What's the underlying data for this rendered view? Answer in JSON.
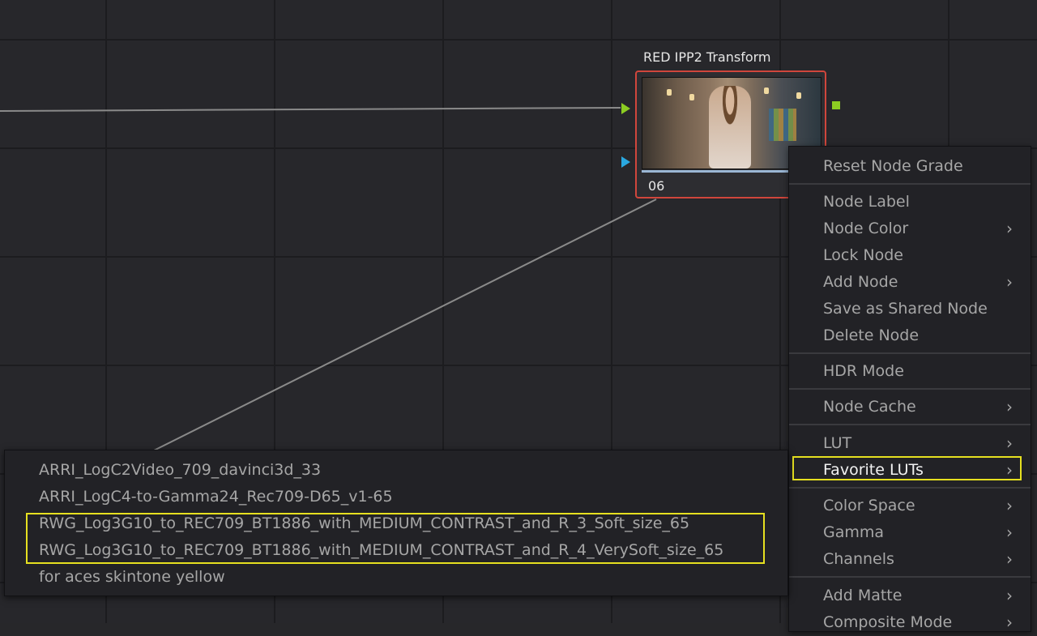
{
  "node": {
    "title": "RED IPP2 Transform",
    "number": "06"
  },
  "context_menu": {
    "items": [
      {
        "label": "Reset Node Grade",
        "submenu": false
      },
      {
        "label": "Node Label",
        "submenu": false
      },
      {
        "label": "Node Color",
        "submenu": true
      },
      {
        "label": "Lock Node",
        "submenu": false
      },
      {
        "label": "Add Node",
        "submenu": true
      },
      {
        "label": "Save as Shared Node",
        "submenu": false
      },
      {
        "label": "Delete Node",
        "submenu": false
      },
      {
        "label": "HDR Mode",
        "submenu": false
      },
      {
        "label": "Node Cache",
        "submenu": true
      },
      {
        "label": "LUT",
        "submenu": true
      },
      {
        "label": "Favorite LUTs",
        "submenu": true,
        "highlighted": true
      },
      {
        "label": "Color Space",
        "submenu": true
      },
      {
        "label": "Gamma",
        "submenu": true
      },
      {
        "label": "Channels",
        "submenu": true
      },
      {
        "label": "Add Matte",
        "submenu": true
      },
      {
        "label": "Composite Mode",
        "submenu": true
      }
    ],
    "chevron": "›"
  },
  "favorite_luts": {
    "items": [
      "ARRI_LogC2Video_709_davinci3d_33",
      "ARRI_LogC4-to-Gamma24_Rec709-D65_v1-65",
      "RWG_Log3G10_to_REC709_BT1886_with_MEDIUM_CONTRAST_and_R_3_Soft_size_65",
      "RWG_Log3G10_to_REC709_BT1886_with_MEDIUM_CONTRAST_and_R_4_VerySoft_size_65",
      "for aces skintone yellow"
    ]
  },
  "colors": {
    "highlight_outline": "#e6e020",
    "node_border": "#d0463c",
    "rgb_port": "#8ccc22",
    "key_port": "#2aa8e0"
  }
}
